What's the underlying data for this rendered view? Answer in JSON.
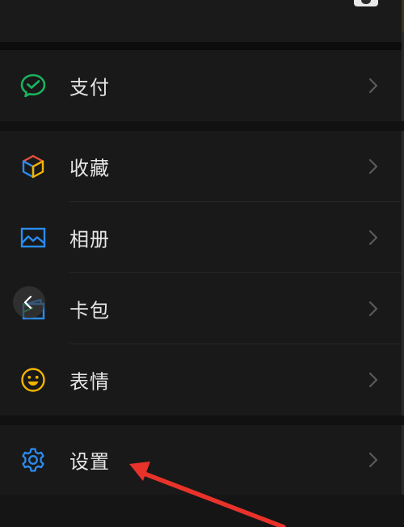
{
  "menu": {
    "pay": {
      "label": "支付",
      "icon": "wechat-pay-icon",
      "color": "#19b35c"
    },
    "favorites": {
      "label": "收藏",
      "icon": "cube-icon",
      "colors": [
        "#e8513c",
        "#2a8cf0",
        "#f5b400"
      ]
    },
    "album": {
      "label": "相册",
      "icon": "image-icon",
      "color": "#2a8cf0"
    },
    "cards": {
      "label": "卡包",
      "icon": "wallet-icon",
      "color": "#2a8cf0"
    },
    "stickers": {
      "label": "表情",
      "icon": "smiley-icon",
      "color": "#f5b400"
    },
    "settings": {
      "label": "设置",
      "icon": "gear-icon",
      "color": "#2a8cf0"
    }
  },
  "annotation": {
    "arrow_color": "#e8322a",
    "icon": "red-arrow-annotation"
  }
}
